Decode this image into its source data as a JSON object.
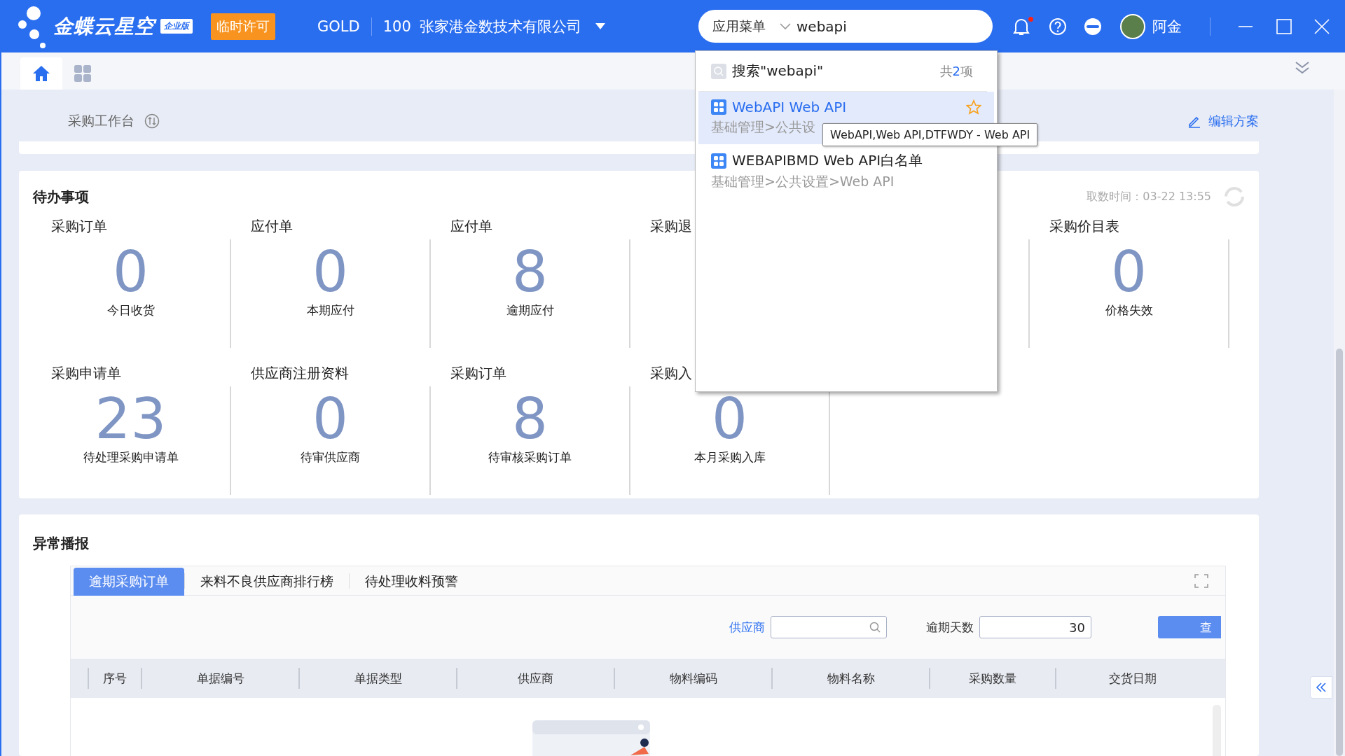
{
  "header": {
    "brand": "金蝶云星空",
    "edition": "企业版",
    "license_badge": "临时许可",
    "data_center": "GOLD",
    "org_code": "100",
    "org_name": "张家港金数技术有限公司",
    "search": {
      "scope": "应用菜单",
      "value": "webapi"
    },
    "notification_dot": true,
    "user": "阿金"
  },
  "tabs": [
    {
      "kind": "home",
      "selected": true
    },
    {
      "kind": "apps",
      "selected": false
    }
  ],
  "workbench": {
    "title": "采购工作台",
    "edit_link": "编辑方案"
  },
  "todo": {
    "title": "待办事项",
    "fetch_time": "取数时间：03-22 13:55",
    "rows": [
      [
        {
          "label": "采购订单",
          "value": "0",
          "caption": "今日收货"
        },
        {
          "label": "应付单",
          "value": "0",
          "caption": "本期应付"
        },
        {
          "label": "应付单",
          "value": "8",
          "caption": "逾期应付"
        },
        {
          "label": "采购退"
        },
        {},
        {
          "label": "采购价目表",
          "value": "0",
          "caption": "价格失效"
        }
      ],
      [
        {
          "label": "采购申请单",
          "value": "23",
          "caption": "待处理采购申请单"
        },
        {
          "label": "供应商注册资料",
          "value": "0",
          "caption": "待审供应商"
        },
        {
          "label": "采购订单",
          "value": "8",
          "caption": "待审核采购订单"
        },
        {
          "label": "采购入",
          "value": "0",
          "caption": "本月采购入库"
        }
      ]
    ]
  },
  "alerts": {
    "title": "异常播报",
    "tabs": [
      {
        "label": "逾期采购订单",
        "selected": true
      },
      {
        "label": "来料不良供应商排行榜",
        "selected": false
      },
      {
        "label": "待处理收料预警",
        "selected": false
      }
    ],
    "filters": {
      "supplier_label": "供应商",
      "days_label": "逾期天数",
      "days_value": "30",
      "query_button": "查"
    },
    "columns": [
      "序号",
      "单据编号",
      "单据类型",
      "供应商",
      "物料编码",
      "物料名称",
      "采购数量",
      "交货日期"
    ]
  },
  "search_dropdown": {
    "query": "搜索\"webapi\"",
    "count_prefix": "共",
    "count": "2",
    "count_suffix": "项",
    "results": [
      {
        "title": "WebAPI Web API",
        "path": "基础管理>公共设",
        "selected": true
      },
      {
        "title": "WEBAPIBMD Web API白名单",
        "path": "基础管理>公共设置>Web API",
        "selected": false
      }
    ],
    "tooltip": "WebAPI,Web API,DTFWDY - Web API"
  }
}
